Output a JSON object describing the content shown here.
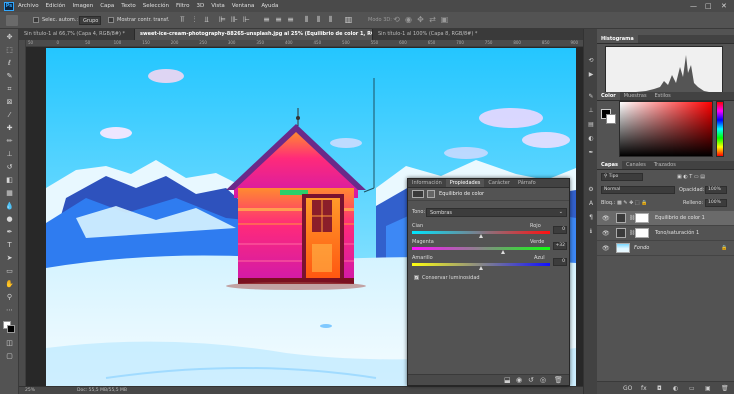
{
  "app": {
    "logo": "Ps",
    "menu": [
      "Archivo",
      "Edición",
      "Imagen",
      "Capa",
      "Texto",
      "Selección",
      "Filtro",
      "3D",
      "Vista",
      "Ventana",
      "Ayuda"
    ],
    "window_controls": [
      "—",
      "□",
      "✕"
    ]
  },
  "options_bar": {
    "auto_select_label": "Selec. autom.:",
    "group_value": "Grupo",
    "show_transform_label": "Mostrar contr. transf.",
    "mode_3d_label": "Modo 3D:"
  },
  "tabs": [
    {
      "label": "Sin título-1 al 66,7% (Capa 4, RGB/8#) *",
      "active": false
    },
    {
      "label": "sweet-ice-cream-photography-88265-unsplash.jpg al 25% (Equilibrio de color 1, RGB/8#) *",
      "active": true
    },
    {
      "label": "Sin título-1 al 100% (Capa 8, RGB/8#) *",
      "active": false
    }
  ],
  "ruler_ticks": [
    "50",
    "0",
    "50",
    "100",
    "150",
    "200",
    "250",
    "300",
    "350",
    "400",
    "450",
    "500",
    "550",
    "600",
    "650",
    "700",
    "750",
    "800",
    "850",
    "900"
  ],
  "status": {
    "zoom": "25%",
    "doc": "Doc: 55,5 MB/55,5 MB"
  },
  "properties": {
    "tabs": [
      "Información",
      "Propiedades",
      "Carácter",
      "Párrafo"
    ],
    "active_tab": "Propiedades",
    "title": "Equilibrio de color",
    "tone_label": "Tono:",
    "tone_value": "Sombras",
    "sliders": [
      {
        "left": "Cian",
        "right": "Rojo",
        "value": "0",
        "position": 0.5
      },
      {
        "left": "Magenta",
        "right": "Verde",
        "value": "+32",
        "position": 0.66
      },
      {
        "left": "Amarillo",
        "right": "Azul",
        "value": "0",
        "position": 0.5
      }
    ],
    "preserve_label": "Conservar luminosidad",
    "preserve_checked": true
  },
  "panels": {
    "histogram_tab": "Histograma",
    "color_tabs": [
      "Color",
      "Muestras",
      "Estilos"
    ],
    "layers_tabs": [
      "Capas",
      "Canales",
      "Trazados"
    ],
    "filter_label": "Tipo",
    "blend_mode": "Normal",
    "opacity_label": "Opacidad:",
    "opacity_value": "100%",
    "lock_label": "Bloq.:",
    "fill_label": "Relleno:",
    "fill_value": "100%",
    "layers": [
      {
        "name": "Equilibrio de color 1",
        "selected": true,
        "kind": "adjustment"
      },
      {
        "name": "Tono/saturación 1",
        "selected": false,
        "kind": "adjustment"
      },
      {
        "name": "Fondo",
        "selected": false,
        "kind": "image"
      }
    ],
    "layer_footer": [
      "GO",
      "fx",
      "◘",
      "◐",
      "▭",
      "▣",
      "🗑"
    ]
  }
}
